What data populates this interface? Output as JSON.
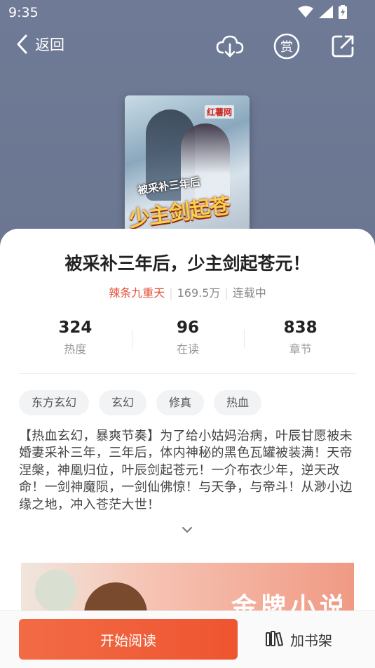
{
  "status_bar": {
    "time": "9:35"
  },
  "nav": {
    "back_label": "返回"
  },
  "cover": {
    "publisher_logo_text": "红薯网",
    "subtitle_text": "被采补三年后",
    "title_text": "少主剑起苍元!"
  },
  "book": {
    "title": "被采补三年后，少主剑起苍元！",
    "author": "辣条九重天",
    "word_count": "169.5万",
    "status": "连载中"
  },
  "stats": [
    {
      "value": "324",
      "label": "热度"
    },
    {
      "value": "96",
      "label": "在读"
    },
    {
      "value": "838",
      "label": "章节"
    }
  ],
  "tags": [
    "东方玄幻",
    "玄幻",
    "修真",
    "热血"
  ],
  "description": "【热血玄幻，暴爽节奏】为了给小姑妈治病，叶辰甘愿被未婚妻采补三年，三年后，体内神秘的黑色瓦罐被装满！天帝涅槃，神凰归位，叶辰剑起苍元！一介布衣少年，逆天改命！一剑神魔陨，一剑仙佛惊！与天争，与帝斗！从渺小边缘之地，冲入苍茫大世！",
  "banner": {
    "text": "金牌小说"
  },
  "bottom": {
    "read_label": "开始阅读",
    "shelf_label": "加书架"
  },
  "colors": {
    "accent": "#ee5a36",
    "author": "#e4533b",
    "header_bg": "#6f7b96"
  },
  "icons": [
    "chevron-left-icon",
    "download-cloud-icon",
    "reward-icon",
    "share-icon",
    "chevron-down-icon",
    "bookshelf-icon",
    "wifi-icon",
    "signal-icon",
    "battery-icon"
  ]
}
